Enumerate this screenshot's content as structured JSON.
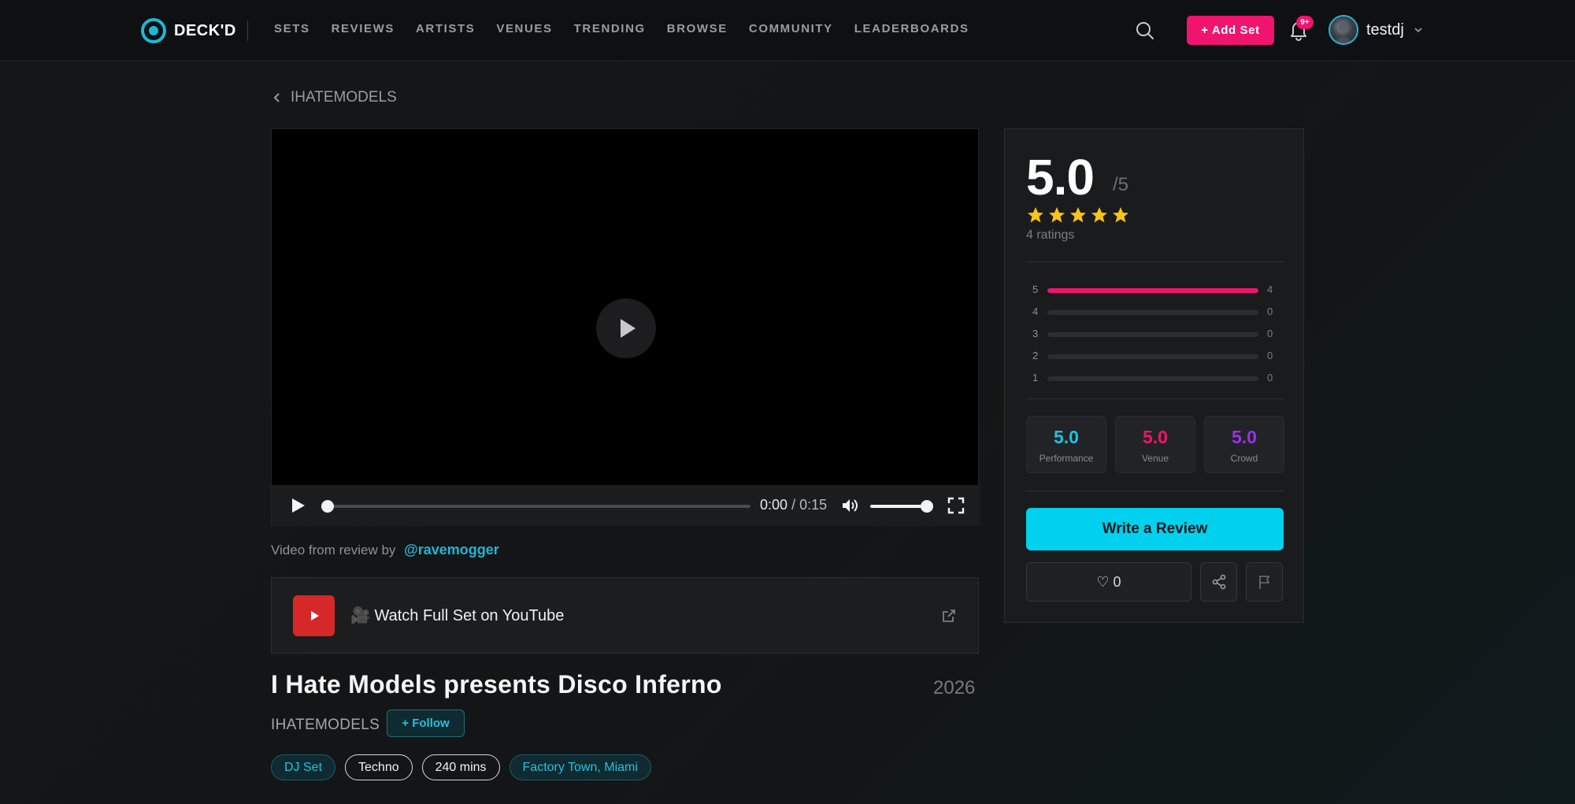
{
  "header": {
    "logo_text": "DECK'D",
    "nav": [
      "SETS",
      "REVIEWS",
      "ARTISTS",
      "VENUES",
      "TRENDING",
      "BROWSE",
      "COMMUNITY",
      "LEADERBOARDS"
    ],
    "add_set_label": "+ Add Set",
    "notification_badge": "9+",
    "username": "testdj"
  },
  "breadcrumb": {
    "back_label": "IHATEMODELS"
  },
  "video": {
    "current_time": "0:00",
    "total_time": "/ 0:15",
    "progress": 0,
    "volume": 1.0
  },
  "review_source": {
    "prefix": "Video from review by",
    "reviewer": "@ravemogger"
  },
  "youtube": {
    "label": "🎥 Watch Full Set on YouTube"
  },
  "set": {
    "title": "I Hate Models presents Disco Inferno",
    "year": "2026",
    "artist": "IHATEMODELS",
    "follow_label": "+ Follow",
    "tags": [
      {
        "label": "DJ Set",
        "style": "cyan"
      },
      {
        "label": "Techno",
        "style": "plain"
      },
      {
        "label": "240 mins",
        "style": "plain"
      },
      {
        "label": "Factory Town, Miami",
        "style": "cyan"
      }
    ]
  },
  "rating": {
    "score": "5.0",
    "out_of": "/5",
    "stars": 5,
    "count_label": "4 ratings",
    "distribution": [
      {
        "level": "5",
        "count": "4",
        "fraction": 1.0
      },
      {
        "level": "4",
        "count": "0",
        "fraction": 0
      },
      {
        "level": "3",
        "count": "0",
        "fraction": 0
      },
      {
        "level": "2",
        "count": "0",
        "fraction": 0
      },
      {
        "level": "1",
        "count": "0",
        "fraction": 0
      }
    ],
    "subscores": [
      {
        "value": "5.0",
        "label": "Performance",
        "color": "#1fc2e0"
      },
      {
        "value": "5.0",
        "label": "Venue",
        "color": "#f0146f"
      },
      {
        "value": "5.0",
        "label": "Crowd",
        "color": "#9d2ff0"
      }
    ],
    "write_review_label": "Write a Review",
    "like_label": "♡ 0"
  },
  "colors": {
    "accent_cyan": "#1fb6d6",
    "accent_pink": "#f0146f",
    "star": "#f5c518"
  }
}
